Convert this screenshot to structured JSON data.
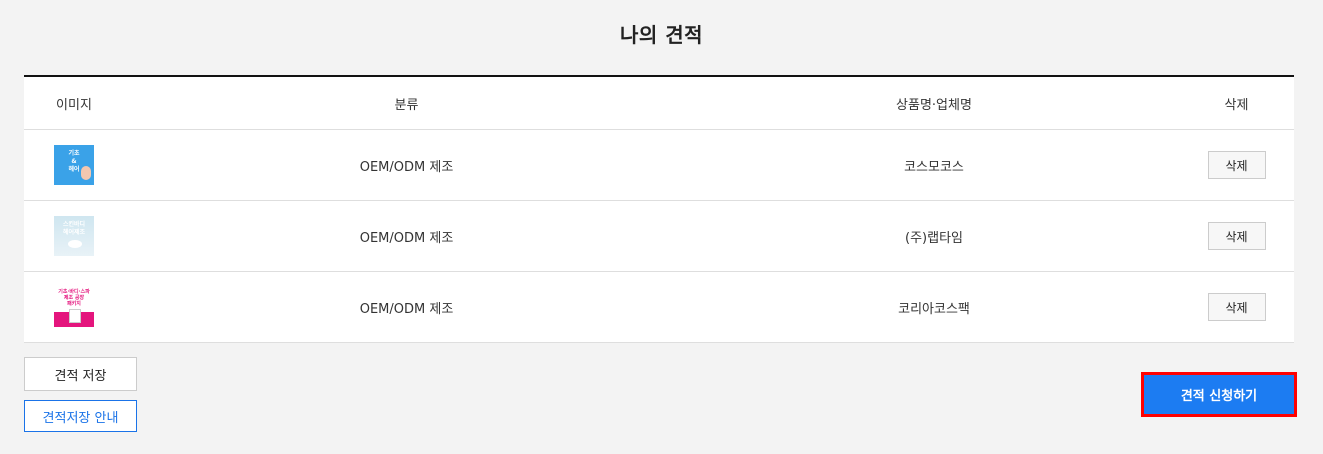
{
  "page": {
    "title": "나의 견적"
  },
  "table": {
    "headers": {
      "image": "이미지",
      "category": "분류",
      "name": "상품명·업체명",
      "delete": "삭제"
    },
    "rows": [
      {
        "thumb_text": "기초\n&\n헤어",
        "category": "OEM/ODM 제조",
        "name": "코스모코스",
        "delete_label": "삭제"
      },
      {
        "thumb_text": "스킨바디\n헤어제조",
        "category": "OEM/ODM 제조",
        "name": "(주)랩타임",
        "delete_label": "삭제"
      },
      {
        "thumb_text": "기초·바디·스파\n제조 공장\n패키지",
        "category": "OEM/ODM 제조",
        "name": "코리아코스팩",
        "delete_label": "삭제"
      }
    ]
  },
  "actions": {
    "save_label": "견적 저장",
    "guide_label": "견적저장 안내",
    "apply_label": "견적 신청하기"
  },
  "colors": {
    "accent": "#1c7cf2",
    "highlight_outline": "#ff0000",
    "guide_border": "#1a73e8"
  }
}
